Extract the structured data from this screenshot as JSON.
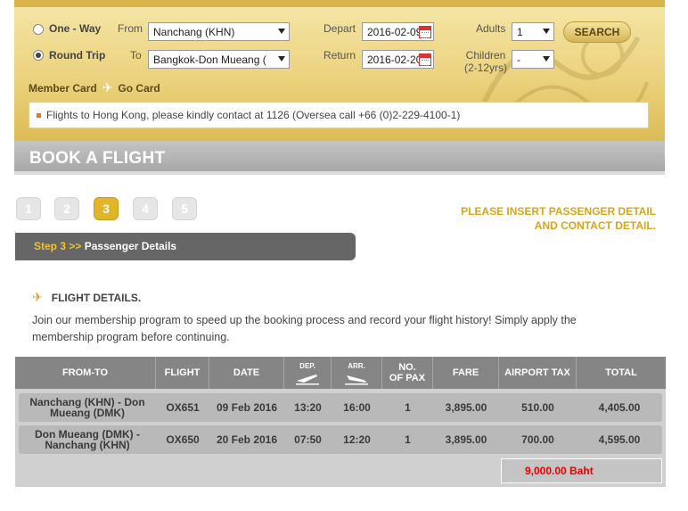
{
  "search": {
    "trip_types": [
      {
        "label": "One - Way",
        "checked": false
      },
      {
        "label": "Round Trip",
        "checked": true
      }
    ],
    "from_label": "From",
    "to_label": "To",
    "from_value": "Nanchang (KHN)",
    "to_value": "Bangkok-Don Mueang (",
    "depart_label": "Depart",
    "return_label": "Return",
    "depart_value": "2016-02-09",
    "return_value": "2016-02-20",
    "adults_label": "Adults",
    "adults_value": "1",
    "children_label": "Children",
    "children_sub": "(2-12yrs)",
    "children_value": "-",
    "search_button": "SEARCH",
    "member_card": "Member Card",
    "go_card": "Go Card",
    "notice": "Flights to Hong Kong, please kindly contact at 1126 (Oversea call +66 (0)2-229-4100-1)"
  },
  "banner": {
    "title": "BOOK A FLIGHT"
  },
  "steps": [
    "1",
    "2",
    "3",
    "4",
    "5"
  ],
  "active_step": 3,
  "instruction": {
    "line1": "PLEASE INSERT PASSENGER DETAIL",
    "line2": "AND CONTACT DETAIL."
  },
  "step_bar": {
    "step": "Step 3 >>",
    "label": "Passenger Details"
  },
  "flight_details": {
    "title": "FLIGHT DETAILS.",
    "description": "Join our membership program to speed up the booking process and record your flight history! Simply apply the membership program before continuing."
  },
  "table": {
    "headers": {
      "from_to": "FROM-TO",
      "flight": "FLIGHT",
      "date": "DATE",
      "dep": "DEP.",
      "arr": "ARR.",
      "pax_1": "NO.",
      "pax_2": "OF PAX",
      "fare": "FARE",
      "tax": "AIRPORT TAX",
      "total": "TOTAL"
    },
    "rows": [
      {
        "from_to_1": "Nanchang (KHN) - Don",
        "from_to_2": "Mueang (DMK)",
        "flight": "OX651",
        "date": "09 Feb 2016",
        "dep": "13:20",
        "arr": "16:00",
        "pax": "1",
        "fare": "3,895.00",
        "tax": "510.00",
        "total": "4,405.00"
      },
      {
        "from_to_1": "Don Mueang (DMK) -",
        "from_to_2": "Nanchang (KHN)",
        "flight": "OX650",
        "date": "20 Feb 2016",
        "dep": "07:50",
        "arr": "12:20",
        "pax": "1",
        "fare": "3,895.00",
        "tax": "700.00",
        "total": "4,595.00"
      }
    ],
    "grand_total": "9,000.00 Baht"
  },
  "colors": {
    "gold": "#e2b529",
    "accent_text": "#d7a41a",
    "total_red": "#ee0000"
  }
}
